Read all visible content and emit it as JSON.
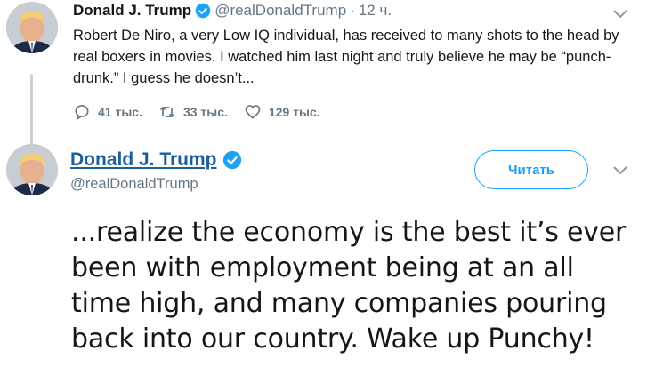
{
  "tweet1": {
    "name": "Donald J. Trump",
    "handle": "@realDonaldTrump",
    "separator": "·",
    "time": "12 ч.",
    "text": "Robert De Niro, a very Low IQ individual, has received to many shots to the head by real boxers in movies. I watched him last night and truly believe he may be “punch-drunk.” I guess he doesn’t...",
    "replies": "41 тыс.",
    "retweets": "33 тыс.",
    "likes": "129 тыс."
  },
  "tweet2": {
    "name": "Donald J. Trump",
    "handle": "@realDonaldTrump",
    "follow_label": "Читать",
    "text": "...realize the economy is the best it’s ever been with employment being at an all time high, and many companies pouring back into our country. Wake up Punchy!"
  },
  "colors": {
    "accent": "#1da1f2",
    "link_name": "#1b5f9c",
    "muted": "#657786",
    "thread_line": "#c8d0d8"
  },
  "icons": [
    "avatar",
    "verified-badge-icon",
    "reply-icon",
    "retweet-icon",
    "like-icon",
    "chevron-down-icon"
  ]
}
